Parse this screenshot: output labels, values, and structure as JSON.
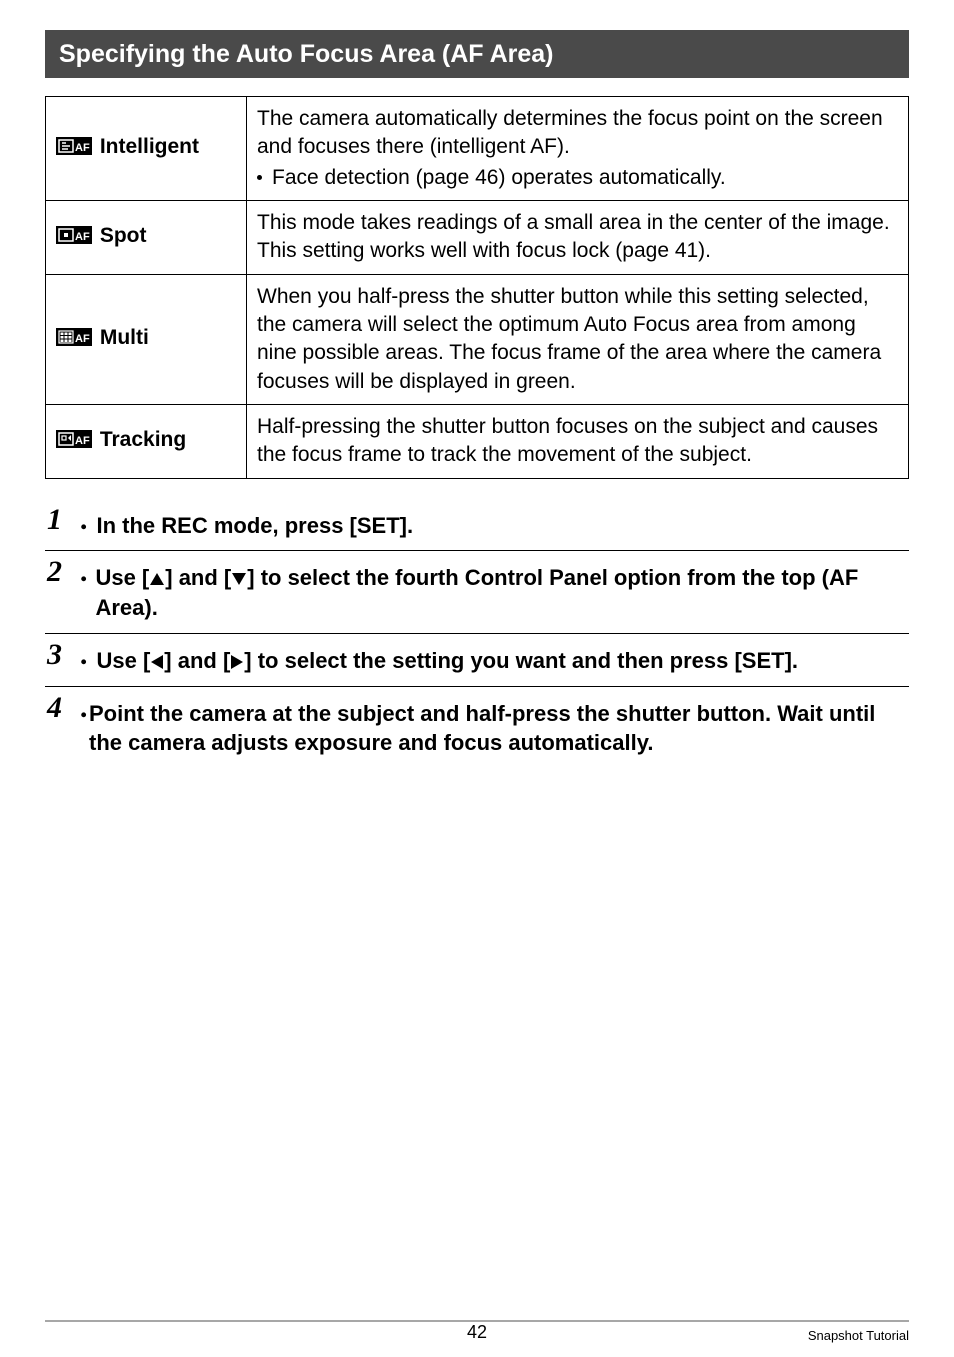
{
  "heading": "Specifying the Auto Focus Area (AF Area)",
  "table": {
    "rows": [
      {
        "icon": "intelligent",
        "label": " Intelligent",
        "desc_line1": "The camera automatically determines the focus point on the screen and focuses there (intelligent AF).",
        "bullet": "Face detection (page 46) operates automatically."
      },
      {
        "icon": "spot",
        "label": " Spot",
        "desc_line1": "This mode takes readings of a small area in the center of the image. This setting works well with focus lock (page 41).",
        "bullet": ""
      },
      {
        "icon": "multi",
        "label": " Multi",
        "desc_line1": "When you half-press the shutter button while this setting selected, the camera will select the optimum Auto Focus area from among nine possible areas. The focus frame of the area where the camera focuses will be displayed in green.",
        "bullet": ""
      },
      {
        "icon": "tracking",
        "label": " Tracking",
        "desc_line1": "Half-pressing the shutter button focuses on the subject and causes the focus frame to track the movement of the subject.",
        "bullet": ""
      }
    ]
  },
  "steps": {
    "s1": {
      "num": "1",
      "text": "In the REC mode, press [SET]."
    },
    "s2": {
      "num": "2",
      "text_a": "Use [",
      "text_b": "] and [",
      "text_c": "] to select the fourth Control Panel option from the top (AF Area)."
    },
    "s3": {
      "num": "3",
      "text_a": "Use [",
      "text_b": "] and [",
      "text_c": "] to select the setting you want and then press [SET]."
    },
    "s4": {
      "num": "4",
      "text": "Point the camera at the subject and half-press the shutter button. Wait until the camera adjusts exposure and focus automatically."
    }
  },
  "footer": {
    "page": "42",
    "crumb": "Snapshot Tutorial"
  }
}
